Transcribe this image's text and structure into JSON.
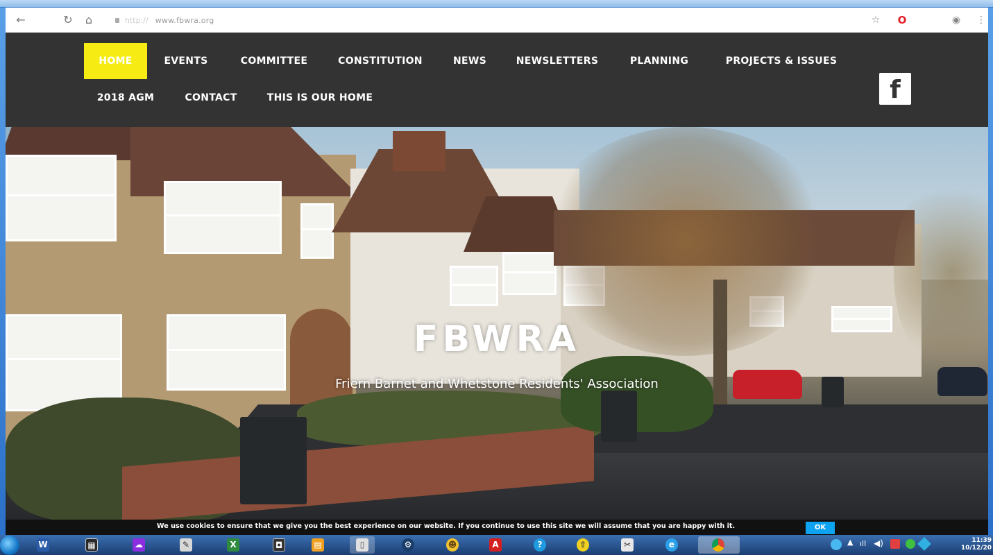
{
  "browser": {
    "url_protocol": "http://",
    "url_host": "www.fbwra.org"
  },
  "menu": {
    "row1": [
      "HOME",
      "EVENTS",
      "COMMITTEE",
      "CONSTITUTION",
      "NEWS",
      "NEWSLETTERS",
      "PLANNING",
      "PROJECTS & ISSUES"
    ],
    "row2": [
      "2018 AGM",
      "CONTACT",
      "THIS IS OUR HOME"
    ],
    "active": "HOME",
    "facebook_glyph": "f"
  },
  "hero": {
    "title": "FBWRA",
    "subtitle": "Friern Barnet and Whetstone Residents' Association"
  },
  "cookie": {
    "text": "We use cookies to ensure that we give you the best experience on our website. If you continue to use this site we will assume that you are happy with it.",
    "ok_label": "OK"
  },
  "taskbar": {
    "clock_time": "11:39",
    "clock_date": "10/12/20"
  },
  "colors": {
    "header_bg": "#333333",
    "active_menu": "#f6ec14",
    "cookie_ok": "#0da3f1",
    "taskbar": "#1b3e72"
  }
}
